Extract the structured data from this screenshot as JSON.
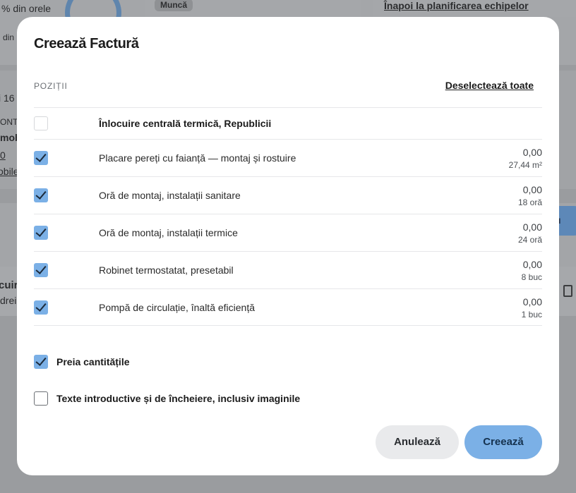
{
  "background": {
    "frag_percent": "% din orele",
    "frag_din": "din",
    "chip": "Muncă",
    "back_link": "Înapoi la planificarea echipelor",
    "frag_16": "i 16",
    "frag_onta": "ONTA",
    "frag_mobi": "mobi",
    "frag_zero": "0",
    "frag_obile": "obile",
    "frag_pill": "u",
    "frag_cuire": "cuire",
    "frag_drei": "drei"
  },
  "modal": {
    "title": "Creează Factură",
    "section_label": "POZIȚII",
    "deselect_all": "Deselectează toate",
    "group": {
      "label": "Înlocuire centrală termică, Republicii",
      "checked": false
    },
    "items": [
      {
        "label": "Placare pereți cu faianță — montaj și rostuire",
        "amount": "0,00",
        "qty": "27,44 m²",
        "checked": true
      },
      {
        "label": "Oră de montaj, instalații sanitare",
        "amount": "0,00",
        "qty": "18 oră",
        "checked": true
      },
      {
        "label": "Oră de montaj, instalații termice",
        "amount": "0,00",
        "qty": "24 oră",
        "checked": true
      },
      {
        "label": "Robinet termostatat, presetabil",
        "amount": "0,00",
        "qty": "8 buc",
        "checked": true
      },
      {
        "label": "Pompă de circulație, înaltă eficiență",
        "amount": "0,00",
        "qty": "1 buc",
        "checked": true
      }
    ],
    "options": {
      "take_quantities": {
        "label": "Preia cantitățile",
        "checked": true
      },
      "intro_texts": {
        "label": "Texte introductive și de încheiere, inclusiv imaginile",
        "checked": false
      }
    },
    "buttons": {
      "cancel": "Anulează",
      "create": "Creează"
    }
  },
  "colors": {
    "accent": "#7bb0e6",
    "overlay": "#9a9c9f",
    "cancel_bg": "#e9eaec"
  }
}
